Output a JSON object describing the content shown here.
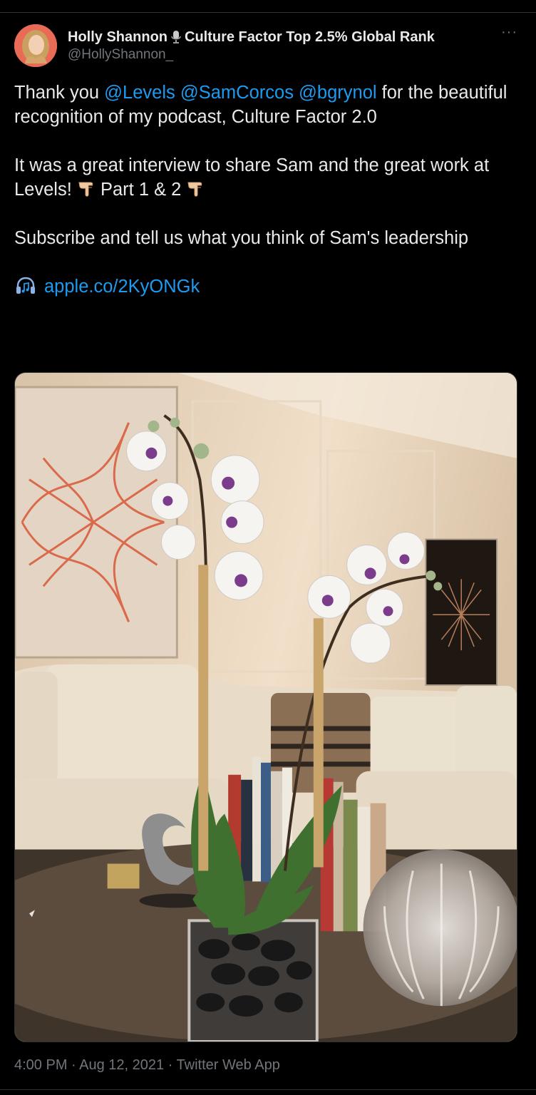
{
  "author": {
    "name": "Holly Shannon",
    "name_suffix": "Culture Factor Top 2.5% Global Rank",
    "handle": "@HollyShannon_"
  },
  "more_label": "···",
  "tweet": {
    "p1": {
      "t1": "Thank you ",
      "m1": "@Levels",
      "m2": "@SamCorcos",
      "m3": "@bgrynol",
      "t2": " for the beautiful recognition of my podcast, Culture Factor 2.0"
    },
    "p2": {
      "t1": "It was a great interview to share Sam and the great work at Levels! ",
      "t2": " Part 1 & 2 "
    },
    "p3": "Subscribe and tell us what you think of Sam's leadership",
    "link": "apple.co/2KyONGk"
  },
  "meta": "4:00 PM · Aug 12, 2021 · Twitter Web App",
  "icons": [
    "microphone-icon",
    "pointing-down-icon",
    "headphones-icon",
    "more-icon"
  ],
  "colors": {
    "background": "#000000",
    "text": "#e7e9ea",
    "secondary": "#71767b",
    "link": "#1d9bf0"
  }
}
